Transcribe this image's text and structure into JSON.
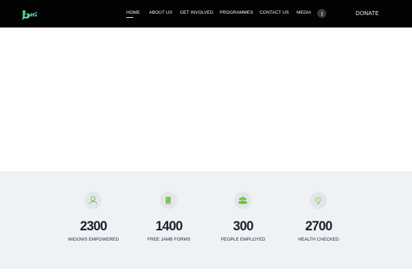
{
  "nav": {
    "items": [
      {
        "label": "HOME",
        "active": true
      },
      {
        "label": "ABOUT US"
      },
      {
        "label": "GET INVOLVED"
      },
      {
        "label": "PROGRAMMES"
      },
      {
        "label": "CONTACT US"
      },
      {
        "label": "MEDIA"
      }
    ],
    "more_icon": "vertical-dots-icon",
    "donate_label": "DONATE"
  },
  "colors": {
    "nav_bg": "#030303",
    "stats_bg": "#eff2f5",
    "accent_green": "#6bbf3a",
    "text_dark": "#1b2231"
  },
  "stats": [
    {
      "value": "2300",
      "label": "WIDOWS EMPOWERED",
      "icon": "person-outline-icon"
    },
    {
      "value": "1400",
      "label": "FREE JAMB FORMS",
      "icon": "book-icon"
    },
    {
      "value": "300",
      "label": "PEOPLE EMPLOYED",
      "icon": "group-icon"
    },
    {
      "value": "2700",
      "label": "HEALTH CHECKED",
      "icon": "lightbulb-icon"
    }
  ]
}
